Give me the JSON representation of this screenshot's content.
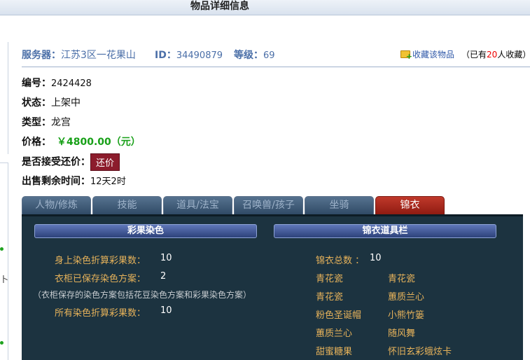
{
  "header": {
    "title": "物品详细信息"
  },
  "left_edge": {
    "mark1": "卜"
  },
  "info": {
    "server_label": "服务器：",
    "server_value": "江苏3区一花果山",
    "id_label": "ID：",
    "id_value": "34490879",
    "level_label": "等级：",
    "level_value": "69",
    "favorite_link": "收藏该物品",
    "fav_prefix": "（已有",
    "fav_count": "20",
    "fav_suffix": "人收藏）"
  },
  "details": {
    "number_label": "编号：",
    "number_value": "2424428",
    "status_label": "状态：",
    "status_value": "上架中",
    "type_label": "类型：",
    "type_value": "龙宫",
    "price_label": "价格：",
    "price_value": "￥4800.00（元）",
    "bargain_label": "是否接受还价：",
    "bargain_button": "还价",
    "time_label": "出售剩余时间：",
    "time_value": "12天2时"
  },
  "tabs": [
    "人物/修炼",
    "技能",
    "道具/法宝",
    "召唤兽/孩子",
    "坐骑",
    "锦衣"
  ],
  "active_tab": 5,
  "colors": {
    "accent": "#4b6fa8",
    "price": "#18a018",
    "bargain": "#8c1c2c",
    "panel_bg": "#1c3340",
    "gold_text": "#e6b25a",
    "active_tab": "#c0392b"
  },
  "dye": {
    "section_title": "彩果染色",
    "body_label": "身上染色折算彩果数：",
    "body_value": "10",
    "wardrobe_label": "衣柜已保存染色方案：",
    "wardrobe_value": "2",
    "note": "（衣柜保存的染色方案包括花豆染色方案和彩果染色方案）",
    "total_label": "所有染色折算彩果数：",
    "total_value": "10"
  },
  "costume": {
    "section_title": "锦衣道具栏",
    "total_label": "锦衣总数 ：",
    "total_value": "10",
    "items": [
      "青花瓷",
      "青花瓷",
      "青花瓷",
      "蕙质兰心",
      "粉色圣诞帽",
      "小熊竹篓",
      "蕙质兰心",
      "随风舞",
      "甜蜜糖果",
      "怀旧玄彩蛾炫卡"
    ]
  }
}
